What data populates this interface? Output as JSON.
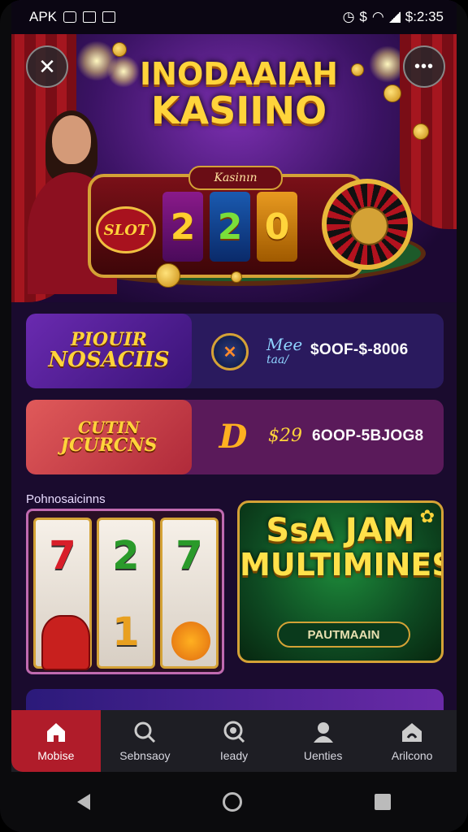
{
  "status_bar": {
    "left_text": "APK",
    "time": "$:2:35"
  },
  "hero": {
    "title_line1": "INODAAIAH",
    "title_line2": "KASIINO",
    "machine_label": "Kasinın",
    "slot_logo": "SLOT",
    "reels": [
      "2",
      "2",
      "0"
    ]
  },
  "promos": [
    {
      "banner_line1": "PIOUIR",
      "banner_line2": "NOSACIIS",
      "mini_line1": "Mee",
      "mini_line2": "taa/",
      "price": "$OOF-$-8006"
    },
    {
      "banner_line1": "CUTIN",
      "banner_line2": "JCURCNS",
      "mini_line1": "$29",
      "price": "6OOP-5BJOG8"
    }
  ],
  "section_label": "Pohnosaicinns",
  "slot_tile": {
    "reels": [
      "7",
      "2",
      "7"
    ],
    "bottom_symbol": "1"
  },
  "feature_tile": {
    "title_line1": "SsA JAM",
    "title_line2": "MULTIMINES",
    "button": "PAUTMAAIN"
  },
  "bottom_nav": [
    {
      "label": "Mobise",
      "icon": "home-icon",
      "active": true
    },
    {
      "label": "Sebnsaoy",
      "icon": "search-icon",
      "active": false
    },
    {
      "label": "Ieady",
      "icon": "magnifier-icon",
      "active": false
    },
    {
      "label": "Uenties",
      "icon": "user-icon",
      "active": false
    },
    {
      "label": "Arilcono",
      "icon": "casino-icon",
      "active": false
    }
  ],
  "colors": {
    "accent_red": "#b01c2a",
    "gold": "#ffd43b",
    "background": "#1a0b2e"
  }
}
